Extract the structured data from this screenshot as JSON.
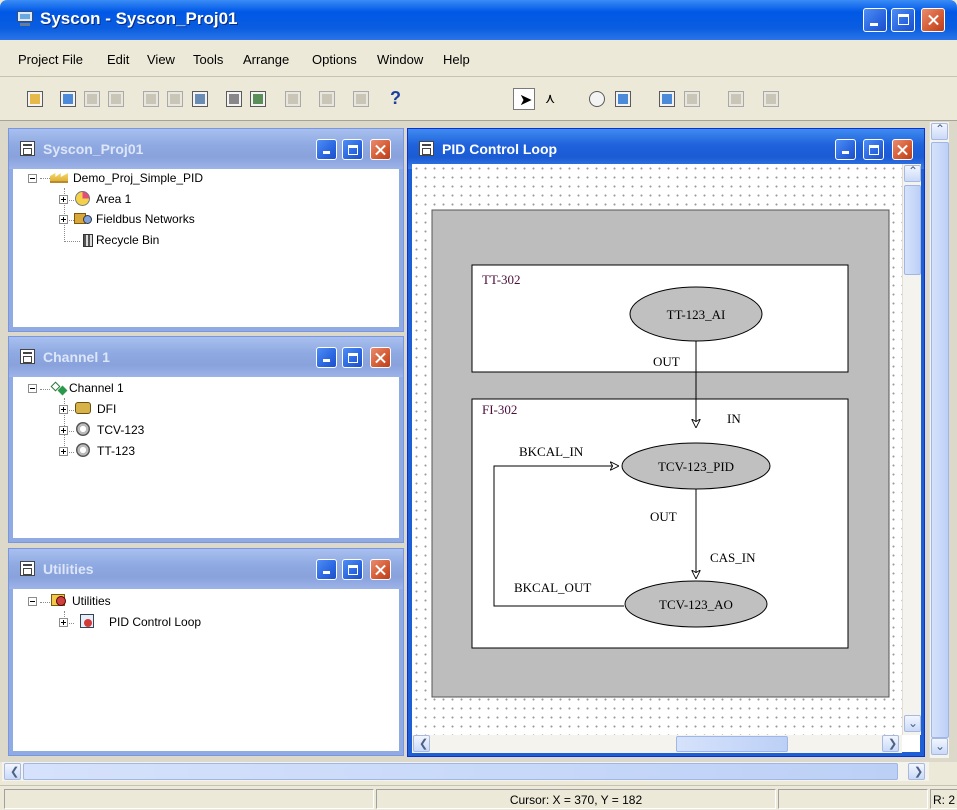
{
  "window": {
    "title": "Syscon - Syscon_Proj01"
  },
  "menu": [
    "Project File",
    "Edit",
    "View",
    "Tools",
    "Arrange",
    "Options",
    "Window",
    "Help"
  ],
  "panels": {
    "project": {
      "title": "Syscon_Proj01",
      "tree": [
        {
          "label": "Demo_Proj_Simple_PID",
          "icon": "plant-icon"
        },
        {
          "label": "Area 1",
          "icon": "area-icon"
        },
        {
          "label": "Fieldbus Networks",
          "icon": "fieldbus-icon"
        },
        {
          "label": "Recycle Bin",
          "icon": "trash-icon"
        }
      ]
    },
    "channel": {
      "title": "Channel 1",
      "tree": [
        {
          "label": "Channel 1",
          "icon": "channel-icon"
        },
        {
          "label": "DFI",
          "icon": "dfi-icon"
        },
        {
          "label": "TCV-123",
          "icon": "device-icon"
        },
        {
          "label": "TT-123",
          "icon": "device-icon"
        }
      ]
    },
    "utilities": {
      "title": "Utilities",
      "tree": [
        {
          "label": "Utilities",
          "icon": "utilities-icon"
        },
        {
          "label": "PID Control Loop",
          "icon": "loop-icon"
        }
      ]
    },
    "pid": {
      "title": "PID Control Loop"
    }
  },
  "diagram": {
    "box_tt": "TT-302",
    "box_fi": "FI-302",
    "block_ai": "TT-123_AI",
    "block_pid": "TCV-123_PID",
    "block_ao": "TCV-123_AO",
    "lbl_out1": "OUT",
    "lbl_in": "IN",
    "lbl_bkcal_in": "BKCAL_IN",
    "lbl_out2": "OUT",
    "lbl_cas_in": "CAS_IN",
    "lbl_bkcal_out": "BKCAL_OUT"
  },
  "status": {
    "cursor": "Cursor: X = 370, Y = 182",
    "right": "R: 2"
  },
  "colors": {
    "accent": "#0a5de0",
    "block_fill": "#c0c0c0",
    "panel_gray": "#bdbdbd"
  }
}
